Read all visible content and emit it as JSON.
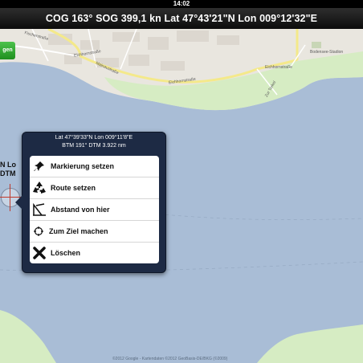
{
  "status_bar": {
    "time": "14:02"
  },
  "nav": {
    "title": "COG 163°  SOG 399,1 kn  Lat 47°43'21\"N   Lon 009°12'32\"E"
  },
  "map": {
    "labels": [
      "Eichhornstraße",
      "Eichhornstraße",
      "Eichhornstraße",
      "Bodensee-Stadion",
      "Mainaustraße",
      "Zur Torkel",
      "Fischerstraße"
    ],
    "copyright": "©2012 Google - Kartendaten ©2012 GeoBasis-DE/BKG (©2009)"
  },
  "green_button": {
    "label": "gen"
  },
  "left_cut": {
    "line1": "N   Lo",
    "line2": "DTM"
  },
  "popup": {
    "coords": "Lat 47°39'33\"N   Lon 009°11'8\"E",
    "bearing": "BTM 191°   DTM 3.922 nm",
    "items": [
      {
        "label": "Markierung setzen",
        "icon": "pin-icon"
      },
      {
        "label": "Route setzen",
        "icon": "recycle-icon"
      },
      {
        "label": "Abstand von hier",
        "icon": "compass-icon"
      },
      {
        "label": "Zum Ziel machen",
        "icon": "target-icon"
      },
      {
        "label": "Löschen",
        "icon": "delete-x-icon"
      }
    ]
  },
  "colors": {
    "water": "#a9bdd6",
    "land": "#e9e6df",
    "popup_bg": "#1d2a44",
    "road": "#f4e98a"
  }
}
